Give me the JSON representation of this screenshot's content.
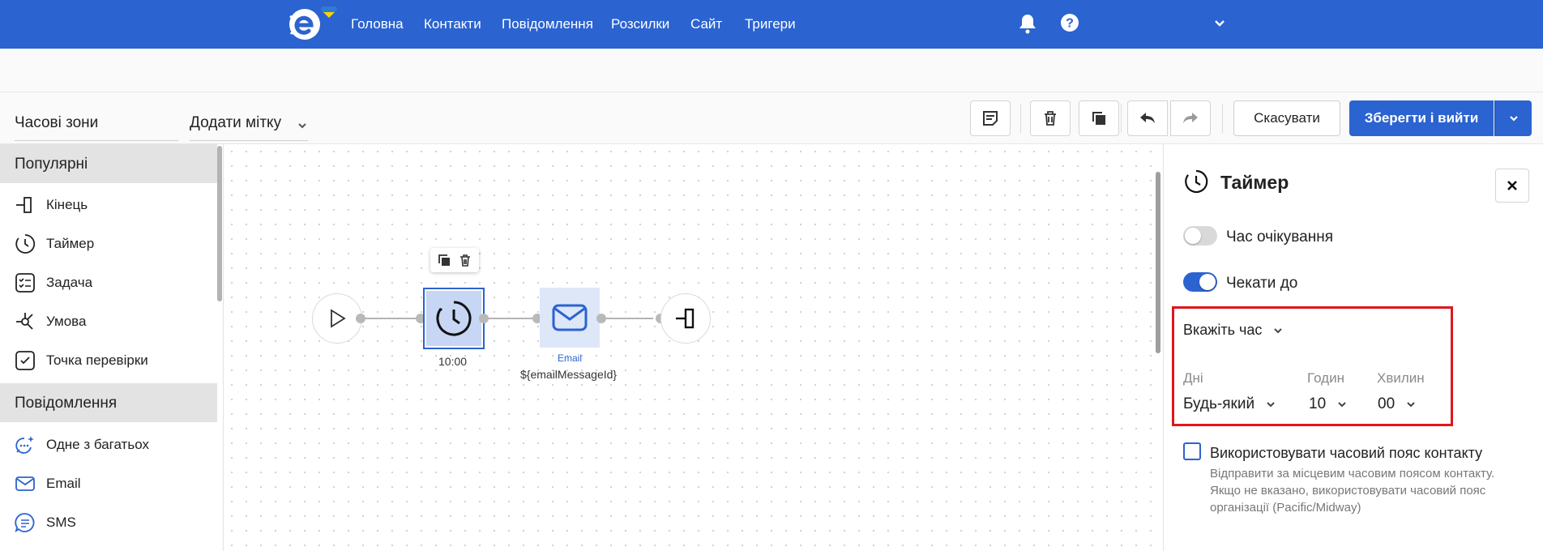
{
  "colors": {
    "primary": "#2b63d0",
    "highlight": "#e0161d",
    "canvas_dot": "#cfcfcf"
  },
  "topnav": {
    "items": [
      "Головна",
      "Контакти",
      "Повідомлення",
      "Розсилки",
      "Сайт",
      "Тригери"
    ],
    "icons": [
      "bell-icon",
      "help-icon",
      "chevron-down-icon"
    ]
  },
  "toolbar": {
    "timezones": "Часові зони",
    "add_tag": "Додати мітку",
    "icons": [
      "notes-icon",
      "trash-icon",
      "copy-icon",
      "undo-icon",
      "redo-icon"
    ],
    "cancel": "Скасувати",
    "save": "Зберегти і вийти"
  },
  "sidebar": {
    "popular_header": "Популярні",
    "popular": [
      {
        "label": "Кінець",
        "icon": "end-icon"
      },
      {
        "label": "Таймер",
        "icon": "timer-icon"
      },
      {
        "label": "Задача",
        "icon": "task-icon"
      },
      {
        "label": "Умова",
        "icon": "condition-icon"
      },
      {
        "label": "Точка перевірки",
        "icon": "checkpoint-icon"
      }
    ],
    "messages_header": "Повідомлення",
    "messages": [
      {
        "label": "Одне з багатьох",
        "icon": "ai-chat-icon"
      },
      {
        "label": "Email",
        "icon": "email-icon"
      },
      {
        "label": "SMS",
        "icon": "sms-icon"
      }
    ]
  },
  "canvas": {
    "timer_label": "10:00",
    "email_type": "Email",
    "email_label": "${emailMessageId}"
  },
  "panel": {
    "title": "Таймер",
    "wait_time": "Час очікування",
    "wait_time_on": false,
    "wait_until": "Чекати до",
    "wait_until_on": true,
    "time_mode": "Вкажіть час",
    "days_label": "Дні",
    "days_value": "Будь-який",
    "hours_label": "Годин",
    "hours_value": "10",
    "minutes_label": "Хвилин",
    "minutes_value": "00",
    "contact_tz_label": "Використовувати часовий пояс контакту",
    "contact_tz_checked": false,
    "contact_tz_help": "Відправити за місцевим часовим поясом контакту. Якщо не вказано, використовувати часовий пояс організації (Pacific/Midway)"
  }
}
